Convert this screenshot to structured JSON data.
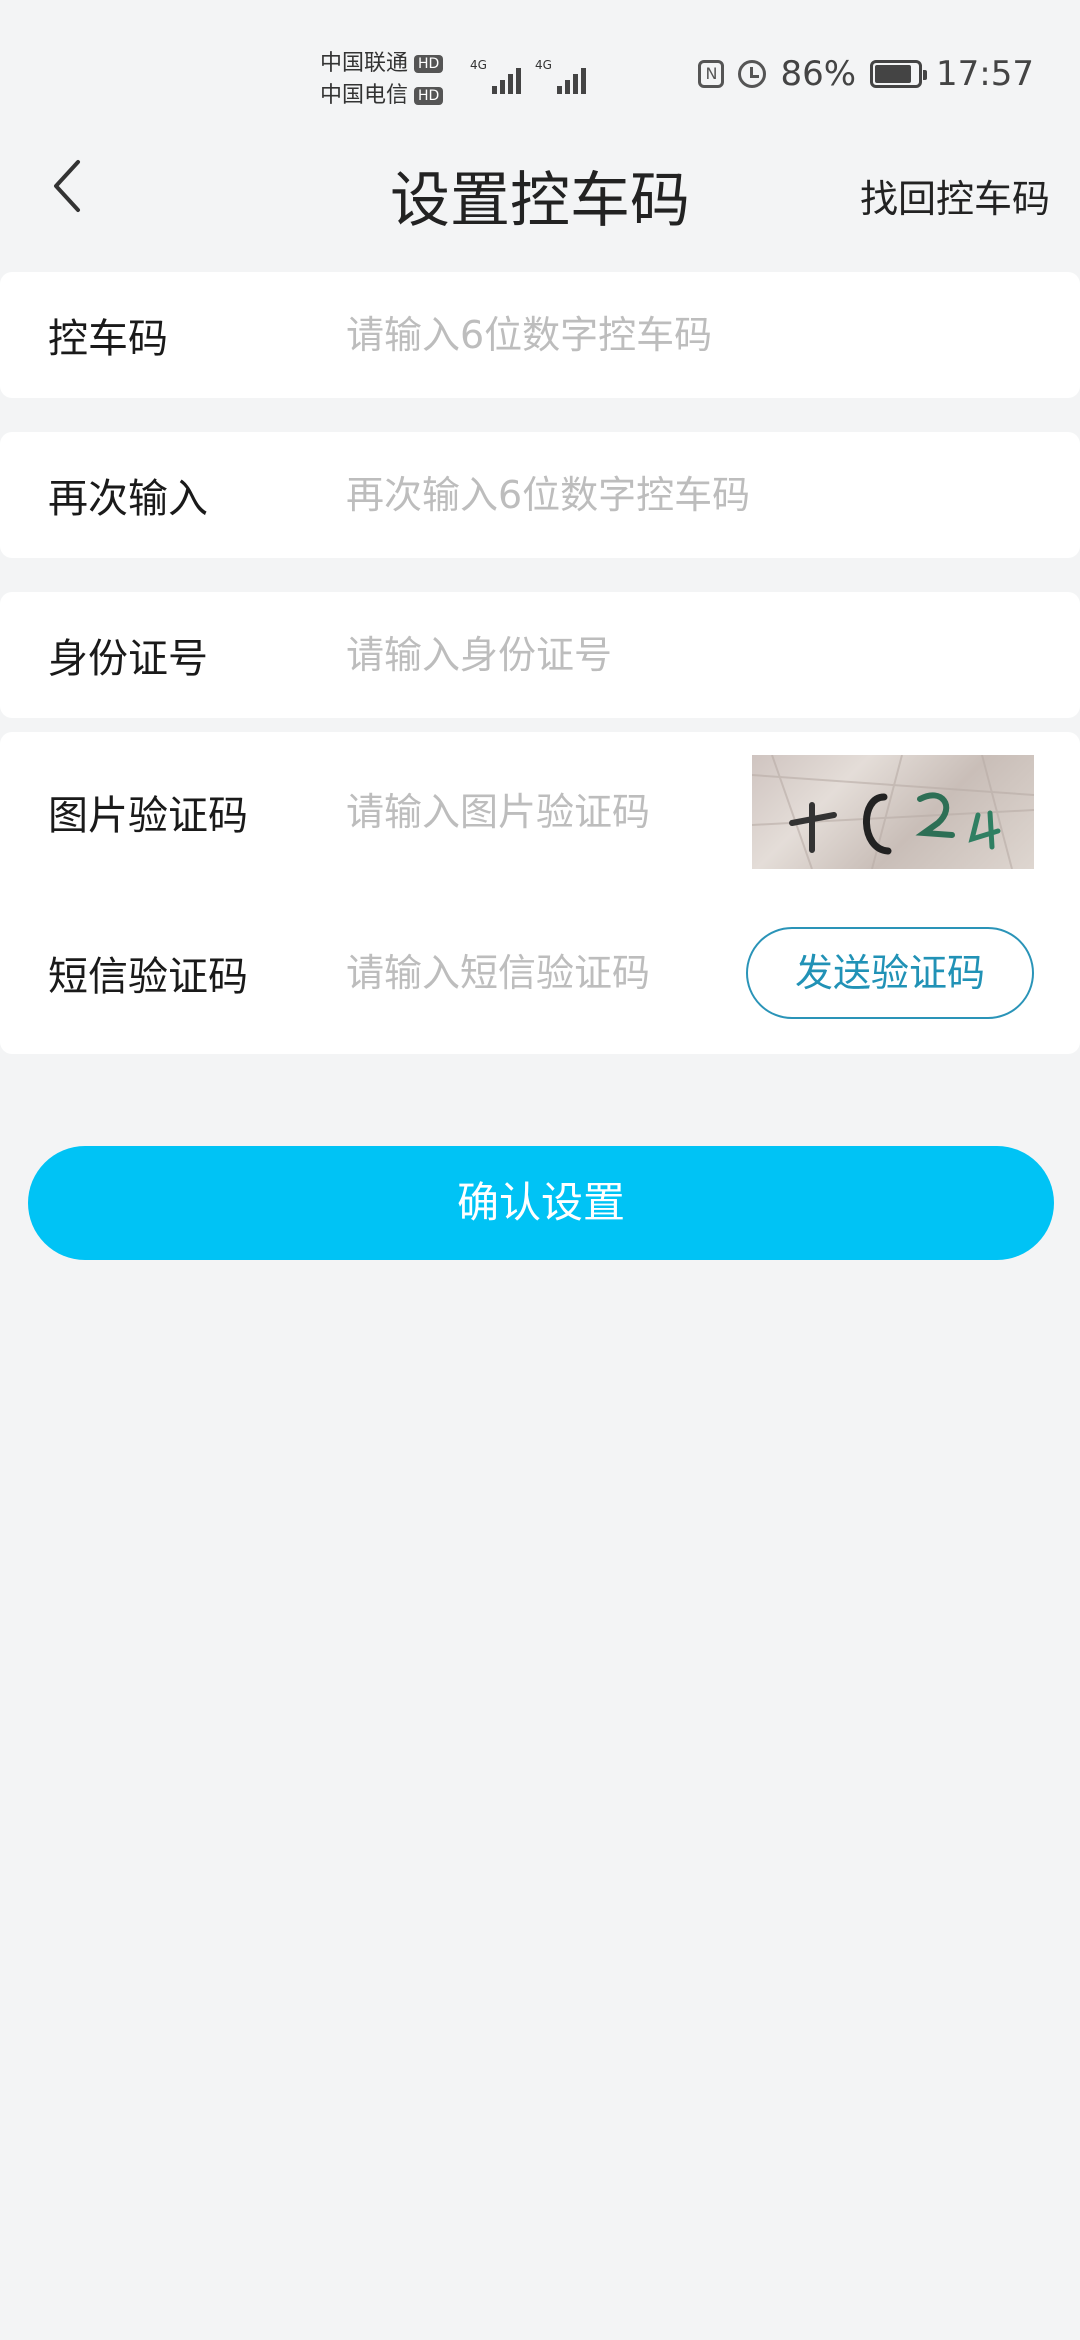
{
  "status_bar": {
    "carrier_1": "中国联通",
    "carrier_2": "中国电信",
    "hd_badge": "HD",
    "network_1": "4G",
    "network_2": "4G",
    "battery_percent": "86%",
    "battery_level": 0.86,
    "time": "17:57",
    "icons": [
      "nfc-icon",
      "alarm-icon",
      "battery-icon"
    ]
  },
  "header": {
    "title": "设置控车码",
    "right_action": "找回控车码",
    "back_icon": "chevron-left-icon"
  },
  "form": {
    "code": {
      "label": "控车码",
      "placeholder": "请输入6位数字控车码",
      "value": ""
    },
    "code_confirm": {
      "label": "再次输入",
      "placeholder": "再次输入6位数字控车码",
      "value": ""
    },
    "id_number": {
      "label": "身份证号",
      "placeholder": "请输入身份证号",
      "value": ""
    },
    "image_captcha": {
      "label": "图片验证码",
      "placeholder": "请输入图片验证码",
      "value": ""
    },
    "sms_code": {
      "label": "短信验证码",
      "placeholder": "请输入短信验证码",
      "value": "",
      "send_button": "发送验证码"
    }
  },
  "confirm_button": "确认设置",
  "colors": {
    "accent": "#00c3f5",
    "link": "#2192b6",
    "background": "#f3f4f5",
    "card": "#ffffff",
    "placeholder": "#bdbdbd"
  }
}
